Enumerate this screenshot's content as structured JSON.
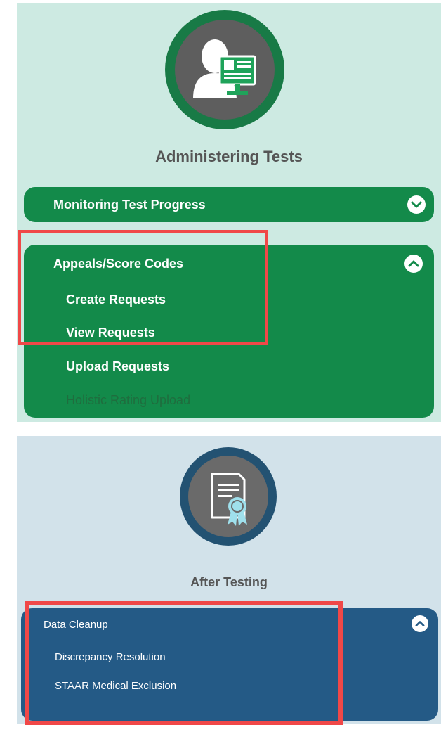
{
  "administering": {
    "title": "Administering Tests",
    "icon": "user-monitor-icon",
    "sections": [
      {
        "label": "Monitoring Test Progress",
        "expanded": false,
        "chevron": "chevron-down-icon"
      },
      {
        "label": "Appeals/Score Codes",
        "expanded": true,
        "chevron": "chevron-up-icon",
        "items": [
          "Create Requests",
          "View Requests",
          "Upload Requests",
          "Holistic Rating Upload"
        ]
      }
    ]
  },
  "after_testing": {
    "title": "After Testing",
    "icon": "certificate-icon",
    "sections": [
      {
        "label": "Data Cleanup",
        "expanded": true,
        "chevron": "chevron-up-icon",
        "items": [
          "Discrepancy Resolution",
          "STAAR Medical Exclusion"
        ]
      }
    ]
  },
  "colors": {
    "green_accent": "#138a4a",
    "blue_accent": "#245a86",
    "highlight": "#f04848"
  }
}
